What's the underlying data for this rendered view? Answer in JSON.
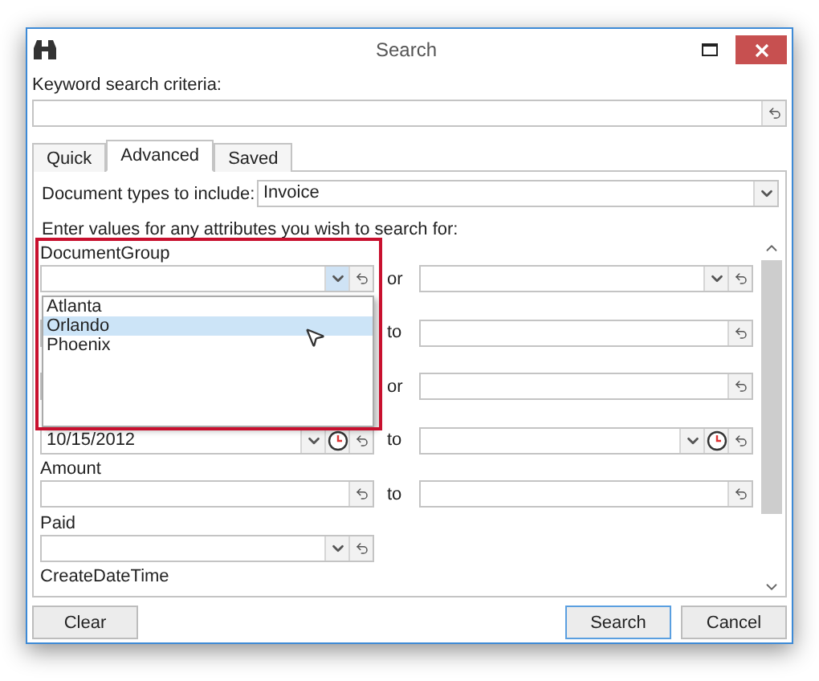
{
  "window": {
    "title": "Search"
  },
  "keyword": {
    "label": "Keyword search criteria:"
  },
  "tabs": [
    {
      "label": "Quick",
      "selected": false
    },
    {
      "label": "Advanced",
      "selected": true
    },
    {
      "label": "Saved",
      "selected": false
    }
  ],
  "document_types": {
    "label": "Document types to include:",
    "value": "Invoice"
  },
  "instructions": "Enter values for any attributes you wish to search for:",
  "attributes": [
    {
      "label": "DocumentGroup",
      "kind": "combo",
      "connector": "or",
      "right": {
        "kind": "combo"
      },
      "expanded": true,
      "options": [
        {
          "label": "Atlanta",
          "selected": false
        },
        {
          "label": "Orlando",
          "selected": true
        },
        {
          "label": "Phoenix",
          "selected": false
        }
      ]
    },
    {
      "kind": "text",
      "connector": "to",
      "right": {
        "kind": "text"
      }
    },
    {
      "kind": "text",
      "connector": "or",
      "right": {
        "kind": "text"
      }
    },
    {
      "kind": "date",
      "value": "10/15/2012",
      "connector": "to",
      "right": {
        "kind": "date"
      }
    },
    {
      "label": "Amount",
      "kind": "text",
      "connector": "to",
      "right": {
        "kind": "text"
      }
    },
    {
      "label": "Paid",
      "kind": "combo",
      "expanded": false
    },
    {
      "label": "CreateDateTime",
      "kind": "none"
    }
  ],
  "buttons_left": [
    {
      "label": "Clear",
      "primary": false
    }
  ],
  "buttons_right": [
    {
      "label": "Search",
      "primary": true
    },
    {
      "label": "Cancel",
      "primary": false
    }
  ]
}
